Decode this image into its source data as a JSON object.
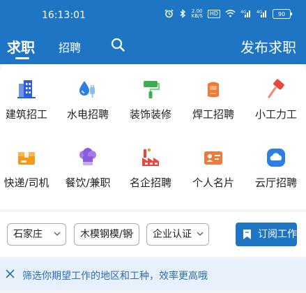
{
  "status_bar": {
    "time": "16:13:01",
    "net_speed_value": "2.00",
    "net_speed_unit": "KB/S",
    "hd_label": "HD",
    "signal_1": "4G",
    "signal_2": "4G",
    "battery": "90"
  },
  "nav": {
    "tab_active": "求职",
    "tab_2": "招聘",
    "publish": "发布求职"
  },
  "categories": [
    {
      "label": "建筑招工",
      "icon": "building-icon",
      "color": "#2c5fd6"
    },
    {
      "label": "水电招聘",
      "icon": "water-drop-plug-icon",
      "color": "#2f7fe0"
    },
    {
      "label": "装饰装修",
      "icon": "paint-roller-icon",
      "color": "#3cae52"
    },
    {
      "label": "焊工招聘",
      "icon": "welding-mask-icon",
      "color": "#f07a3a"
    },
    {
      "label": "小工力工",
      "icon": "hammer-icon",
      "color": "#e8473b"
    },
    {
      "label": "快递/司机",
      "icon": "package-box-icon",
      "color": "#f39a1e"
    },
    {
      "label": "餐饮/兼职",
      "icon": "chef-hat-icon",
      "color": "#8a5ce0"
    },
    {
      "label": "名企招聘",
      "icon": "factory-icon",
      "color": "#e8473b"
    },
    {
      "label": "个人名片",
      "icon": "business-card-icon",
      "color": "#f07a3a"
    },
    {
      "label": "云厅招聘",
      "icon": "cloud-icon",
      "color": "#2f7fe0"
    }
  ],
  "filters": {
    "city": "石家庄",
    "trade": "木模钢模/钢",
    "cert": "企业认证",
    "subscribe": "订阅工作"
  },
  "tip": {
    "text": "筛选你期望工作的地区和工种，效率更高哦"
  }
}
